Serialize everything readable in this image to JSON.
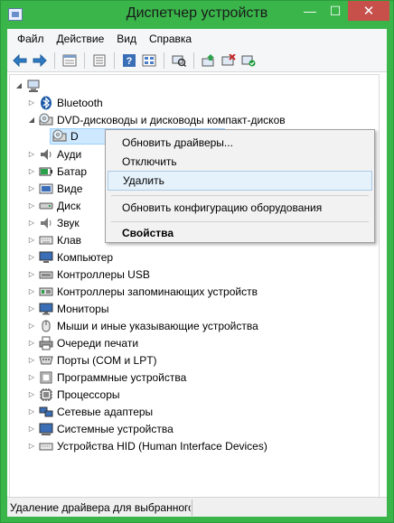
{
  "window": {
    "title": "Диспетчер устройств",
    "minimize": "—",
    "maximize": "☐",
    "close": "✕",
    "accent": "#39B54A"
  },
  "menubar": {
    "items": [
      "Файл",
      "Действие",
      "Вид",
      "Справка"
    ]
  },
  "toolbar": {
    "icons": [
      "back-arrow-icon",
      "forward-arrow-icon",
      "properties-icon",
      "show-hidden-icon",
      "help-icon",
      "view-by-type-icon",
      "scan-hardware-icon",
      "update-driver-icon",
      "disable-device-icon",
      "uninstall-device-icon"
    ]
  },
  "tree": {
    "root_label": "",
    "items": [
      {
        "label": "Bluetooth",
        "icon": "bluetooth-icon",
        "expanded": false
      },
      {
        "label": "DVD-дисководы и дисководы компакт-дисков",
        "icon": "dvd-drive-icon",
        "expanded": true
      },
      {
        "label": "D",
        "icon": "dvd-device-icon",
        "child": true,
        "selected": true
      },
      {
        "label": "Ауди",
        "icon": "audio-icon"
      },
      {
        "label": "Батар",
        "icon": "battery-icon"
      },
      {
        "label": "Виде",
        "icon": "video-icon"
      },
      {
        "label": "Диск",
        "icon": "disk-icon"
      },
      {
        "label": "Звук",
        "icon": "sound-icon"
      },
      {
        "label": "Клав",
        "icon": "keyboard-icon"
      },
      {
        "label": "Компьютер",
        "icon": "computer-icon"
      },
      {
        "label": "Контроллеры USB",
        "icon": "usb-icon"
      },
      {
        "label": "Контроллеры запоминающих устройств",
        "icon": "storage-controller-icon"
      },
      {
        "label": "Мониторы",
        "icon": "monitor-icon"
      },
      {
        "label": "Мыши и иные указывающие устройства",
        "icon": "mouse-icon"
      },
      {
        "label": "Очереди печати",
        "icon": "printer-icon"
      },
      {
        "label": "Порты (COM и LPT)",
        "icon": "port-icon"
      },
      {
        "label": "Программные устройства",
        "icon": "software-device-icon"
      },
      {
        "label": "Процессоры",
        "icon": "processor-icon"
      },
      {
        "label": "Сетевые адаптеры",
        "icon": "network-icon"
      },
      {
        "label": "Системные устройства",
        "icon": "system-device-icon"
      },
      {
        "label": "Устройства HID (Human Interface Devices)",
        "icon": "hid-icon"
      }
    ]
  },
  "context_menu": {
    "update_drivers": "Обновить драйверы...",
    "disable": "Отключить",
    "uninstall": "Удалить",
    "scan_hardware": "Обновить конфигурацию оборудования",
    "properties": "Свойства"
  },
  "statusbar": {
    "text": "Удаление драйвера для выбранного"
  }
}
